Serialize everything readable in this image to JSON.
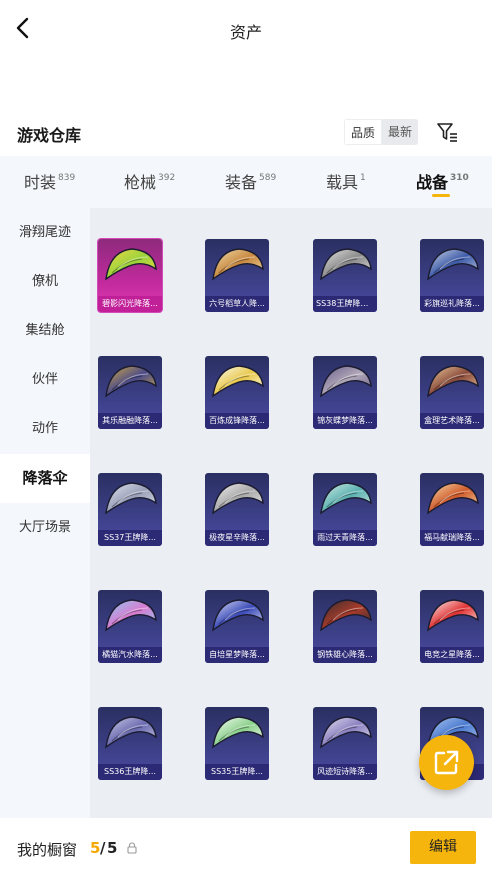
{
  "header": {
    "title": "资产"
  },
  "section": {
    "title": "游戏仓库"
  },
  "sort": {
    "quality": "品质",
    "latest": "最新"
  },
  "tabs": [
    {
      "label": "时装",
      "count": "839"
    },
    {
      "label": "枪械",
      "count": "392"
    },
    {
      "label": "装备",
      "count": "589"
    },
    {
      "label": "载具",
      "count": "1"
    },
    {
      "label": "战备",
      "count": "310"
    }
  ],
  "sidebar": {
    "items": [
      {
        "label": "滑翔尾迹"
      },
      {
        "label": "僚机"
      },
      {
        "label": "集结舱"
      },
      {
        "label": "伙伴"
      },
      {
        "label": "动作"
      },
      {
        "label": "降落伞"
      },
      {
        "label": "大厅场景"
      }
    ]
  },
  "cards": [
    {
      "label": "碧影闪光降落...",
      "palette": [
        "#9ad33a",
        "#f2d94a"
      ]
    },
    {
      "label": "六号稻草人降...",
      "palette": [
        "#c8883e",
        "#f0e0b0"
      ]
    },
    {
      "label": "SS38王牌降落...",
      "palette": [
        "#8a8a8a",
        "#e8e8e8"
      ]
    },
    {
      "label": "彩旗巡礼降落...",
      "palette": [
        "#3c5aa8",
        "#d0d8e8"
      ]
    },
    {
      "label": "其乐融融降落...",
      "palette": [
        "#4a4a8a",
        "#d8b040"
      ]
    },
    {
      "label": "百炼成锋降落...",
      "palette": [
        "#e8c84a",
        "#ffffff"
      ]
    },
    {
      "label": "锦灰蝶梦降落...",
      "palette": [
        "#b0a8b8",
        "#6a5a8a"
      ]
    },
    {
      "label": "盒理艺术降落...",
      "palette": [
        "#8a4a3a",
        "#f0d0a0"
      ]
    },
    {
      "label": "SS37王牌降...",
      "palette": [
        "#9aa0b8",
        "#e0e4f0"
      ]
    },
    {
      "label": "极夜星辛降落...",
      "palette": [
        "#a8a8a8",
        "#f4f4f4"
      ]
    },
    {
      "label": "雨过天青降落...",
      "palette": [
        "#5ab0b0",
        "#d8f0e8"
      ]
    },
    {
      "label": "福马献瑞降落...",
      "palette": [
        "#d05a2a",
        "#f8e0b0"
      ]
    },
    {
      "label": "橘猫汽水降落...",
      "palette": [
        "#d87ad0",
        "#8ad0f0"
      ]
    },
    {
      "label": "自培星梦降落...",
      "palette": [
        "#3a4ab8",
        "#e0e4f8"
      ]
    },
    {
      "label": "钢铁雄心降落...",
      "palette": [
        "#a83a2a",
        "#303030"
      ]
    },
    {
      "label": "电竞之星降落...",
      "palette": [
        "#e03030",
        "#ffffff"
      ]
    },
    {
      "label": "SS36王牌降...",
      "palette": [
        "#6a6ab0",
        "#d0d0e8"
      ]
    },
    {
      "label": "SS35王牌降...",
      "palette": [
        "#8ad08a",
        "#ffffff"
      ]
    },
    {
      "label": "风迹短诗降落...",
      "palette": [
        "#8a80c0",
        "#e8e4f0"
      ]
    },
    {
      "label": "",
      "palette": [
        "#4a7ad0",
        "#b0c8f0"
      ]
    }
  ],
  "footer": {
    "showcase_label": "我的橱窗",
    "count_current": "5",
    "count_separator": "/",
    "count_max": "5",
    "edit_label": "编辑"
  },
  "colors": {
    "accent": "#f5b50d",
    "tab_bg": "#f4f7fb",
    "grid_bg": "#ebeef3"
  }
}
